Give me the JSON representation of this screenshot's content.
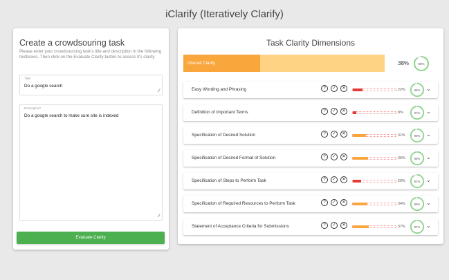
{
  "app": {
    "title": "iClarify (Iteratively Clarify)"
  },
  "task_form": {
    "heading": "Create a crowdsouring task",
    "instructions": "Please enter your crowdsourcing task's title and description in the following textboxes. Then click on the Evaluate Clarity button to assess it's clarity.",
    "title_field": {
      "label": "Title*",
      "value": "Do a google search"
    },
    "description_field": {
      "label": "Description*",
      "value": "Do a google search to make sure site is indexed"
    },
    "evaluate_button": "Evaluate Clarity"
  },
  "dimensions_panel": {
    "heading": "Task Clarity Dimensions",
    "overall": {
      "label": "Overall Clarity",
      "percent_text": "38%",
      "fraction": 0.38,
      "confidence_text": "90%",
      "confidence": 0.9
    },
    "icons": [
      "help-icon",
      "check-circle-icon",
      "cancel-circle-icon",
      "chevron-down-icon"
    ],
    "dimensions": [
      {
        "name": "Easy Wording and Phrasing",
        "percent_text": "22%",
        "fraction": 0.22,
        "confidence_text": "95%",
        "confidence": 0.95,
        "level": "low"
      },
      {
        "name": "Definition of Important Terms",
        "percent_text": "8%",
        "fraction": 0.08,
        "confidence_text": "97%",
        "confidence": 0.97,
        "level": "low"
      },
      {
        "name": "Specification of Desired Solution",
        "percent_text": "31%",
        "fraction": 0.31,
        "confidence_text": "95%",
        "confidence": 0.95,
        "level": "medium"
      },
      {
        "name": "Specification of Desired Format of Solution",
        "percent_text": "36%",
        "fraction": 0.36,
        "confidence_text": "98%",
        "confidence": 0.98,
        "level": "medium"
      },
      {
        "name": "Specification of Steps to Perform Task",
        "percent_text": "20%",
        "fraction": 0.2,
        "confidence_text": "91%",
        "confidence": 0.91,
        "level": "low"
      },
      {
        "name": "Specification of Required Resources to Perform Task",
        "percent_text": "34%",
        "fraction": 0.34,
        "confidence_text": "96%",
        "confidence": 0.96,
        "level": "medium"
      },
      {
        "name": "Statement of Acceptance Criteria for Submissions",
        "percent_text": "37%",
        "fraction": 0.37,
        "confidence_text": "97%",
        "confidence": 0.97,
        "level": "medium"
      }
    ]
  },
  "colors": {
    "accent_green": "#4caf50",
    "overall_fill": "#f9a63c",
    "overall_track": "#ffd384",
    "low_fill": "#e53935",
    "medium_fill": "#f9a63c",
    "circle_ring": "#8ed48e"
  }
}
